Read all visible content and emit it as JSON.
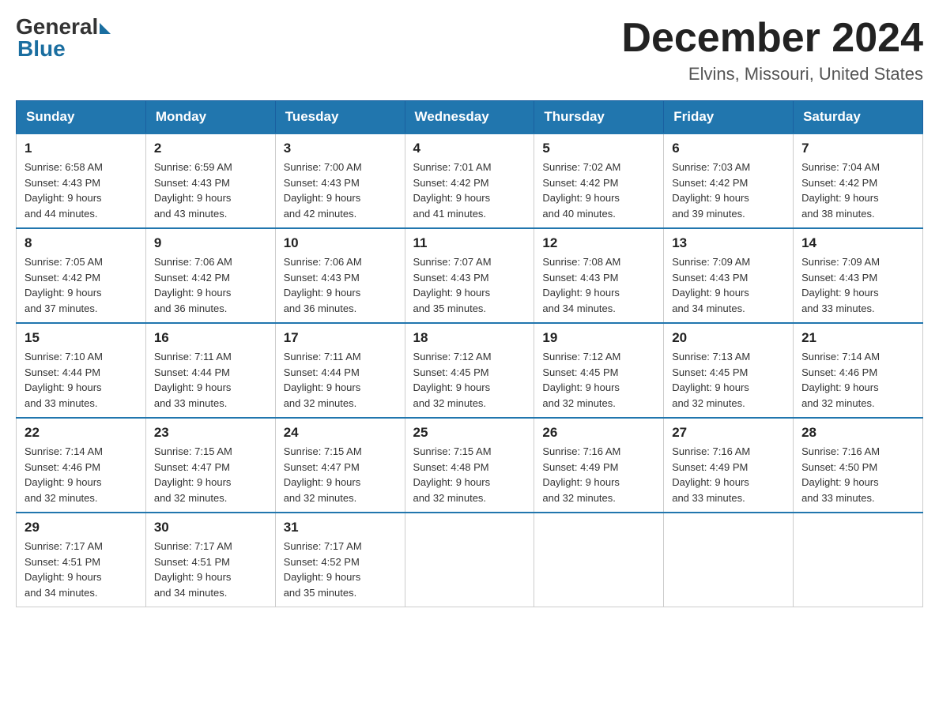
{
  "header": {
    "logo_general": "General",
    "logo_blue": "Blue",
    "month_title": "December 2024",
    "location": "Elvins, Missouri, United States"
  },
  "weekdays": [
    "Sunday",
    "Monday",
    "Tuesday",
    "Wednesday",
    "Thursday",
    "Friday",
    "Saturday"
  ],
  "weeks": [
    [
      {
        "day": "1",
        "sunrise": "6:58 AM",
        "sunset": "4:43 PM",
        "daylight": "9 hours and 44 minutes."
      },
      {
        "day": "2",
        "sunrise": "6:59 AM",
        "sunset": "4:43 PM",
        "daylight": "9 hours and 43 minutes."
      },
      {
        "day": "3",
        "sunrise": "7:00 AM",
        "sunset": "4:43 PM",
        "daylight": "9 hours and 42 minutes."
      },
      {
        "day": "4",
        "sunrise": "7:01 AM",
        "sunset": "4:42 PM",
        "daylight": "9 hours and 41 minutes."
      },
      {
        "day": "5",
        "sunrise": "7:02 AM",
        "sunset": "4:42 PM",
        "daylight": "9 hours and 40 minutes."
      },
      {
        "day": "6",
        "sunrise": "7:03 AM",
        "sunset": "4:42 PM",
        "daylight": "9 hours and 39 minutes."
      },
      {
        "day": "7",
        "sunrise": "7:04 AM",
        "sunset": "4:42 PM",
        "daylight": "9 hours and 38 minutes."
      }
    ],
    [
      {
        "day": "8",
        "sunrise": "7:05 AM",
        "sunset": "4:42 PM",
        "daylight": "9 hours and 37 minutes."
      },
      {
        "day": "9",
        "sunrise": "7:06 AM",
        "sunset": "4:42 PM",
        "daylight": "9 hours and 36 minutes."
      },
      {
        "day": "10",
        "sunrise": "7:06 AM",
        "sunset": "4:43 PM",
        "daylight": "9 hours and 36 minutes."
      },
      {
        "day": "11",
        "sunrise": "7:07 AM",
        "sunset": "4:43 PM",
        "daylight": "9 hours and 35 minutes."
      },
      {
        "day": "12",
        "sunrise": "7:08 AM",
        "sunset": "4:43 PM",
        "daylight": "9 hours and 34 minutes."
      },
      {
        "day": "13",
        "sunrise": "7:09 AM",
        "sunset": "4:43 PM",
        "daylight": "9 hours and 34 minutes."
      },
      {
        "day": "14",
        "sunrise": "7:09 AM",
        "sunset": "4:43 PM",
        "daylight": "9 hours and 33 minutes."
      }
    ],
    [
      {
        "day": "15",
        "sunrise": "7:10 AM",
        "sunset": "4:44 PM",
        "daylight": "9 hours and 33 minutes."
      },
      {
        "day": "16",
        "sunrise": "7:11 AM",
        "sunset": "4:44 PM",
        "daylight": "9 hours and 33 minutes."
      },
      {
        "day": "17",
        "sunrise": "7:11 AM",
        "sunset": "4:44 PM",
        "daylight": "9 hours and 32 minutes."
      },
      {
        "day": "18",
        "sunrise": "7:12 AM",
        "sunset": "4:45 PM",
        "daylight": "9 hours and 32 minutes."
      },
      {
        "day": "19",
        "sunrise": "7:12 AM",
        "sunset": "4:45 PM",
        "daylight": "9 hours and 32 minutes."
      },
      {
        "day": "20",
        "sunrise": "7:13 AM",
        "sunset": "4:45 PM",
        "daylight": "9 hours and 32 minutes."
      },
      {
        "day": "21",
        "sunrise": "7:14 AM",
        "sunset": "4:46 PM",
        "daylight": "9 hours and 32 minutes."
      }
    ],
    [
      {
        "day": "22",
        "sunrise": "7:14 AM",
        "sunset": "4:46 PM",
        "daylight": "9 hours and 32 minutes."
      },
      {
        "day": "23",
        "sunrise": "7:15 AM",
        "sunset": "4:47 PM",
        "daylight": "9 hours and 32 minutes."
      },
      {
        "day": "24",
        "sunrise": "7:15 AM",
        "sunset": "4:47 PM",
        "daylight": "9 hours and 32 minutes."
      },
      {
        "day": "25",
        "sunrise": "7:15 AM",
        "sunset": "4:48 PM",
        "daylight": "9 hours and 32 minutes."
      },
      {
        "day": "26",
        "sunrise": "7:16 AM",
        "sunset": "4:49 PM",
        "daylight": "9 hours and 32 minutes."
      },
      {
        "day": "27",
        "sunrise": "7:16 AM",
        "sunset": "4:49 PM",
        "daylight": "9 hours and 33 minutes."
      },
      {
        "day": "28",
        "sunrise": "7:16 AM",
        "sunset": "4:50 PM",
        "daylight": "9 hours and 33 minutes."
      }
    ],
    [
      {
        "day": "29",
        "sunrise": "7:17 AM",
        "sunset": "4:51 PM",
        "daylight": "9 hours and 34 minutes."
      },
      {
        "day": "30",
        "sunrise": "7:17 AM",
        "sunset": "4:51 PM",
        "daylight": "9 hours and 34 minutes."
      },
      {
        "day": "31",
        "sunrise": "7:17 AM",
        "sunset": "4:52 PM",
        "daylight": "9 hours and 35 minutes."
      },
      null,
      null,
      null,
      null
    ]
  ],
  "labels": {
    "sunrise": "Sunrise:",
    "sunset": "Sunset:",
    "daylight": "Daylight:"
  }
}
